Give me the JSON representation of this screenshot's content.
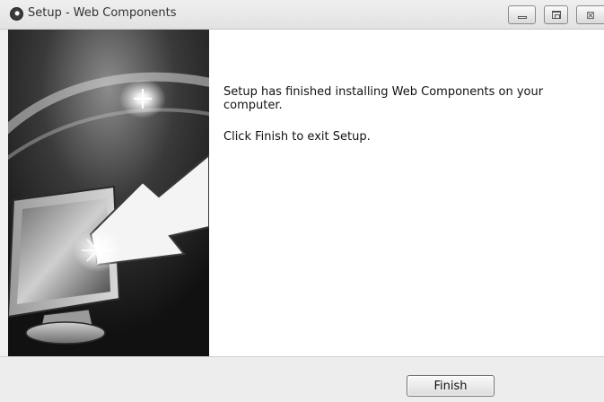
{
  "window": {
    "title": "Setup - Web Components",
    "controls": {
      "minimize_icon": "minimize-icon",
      "maximize_icon": "maximize-icon",
      "close_icon": "close-icon"
    }
  },
  "sidebar": {
    "image": "monitor-with-arrow"
  },
  "content": {
    "message_line1": "Setup has finished installing Web Components on your computer.",
    "message_line2": "Click Finish to exit Setup."
  },
  "footer": {
    "finish_label": "Finish"
  },
  "colors": {
    "window_bg": "#f0f0f0",
    "panel_bg": "#ffffff",
    "banner_bg": "#1b1b1b"
  }
}
